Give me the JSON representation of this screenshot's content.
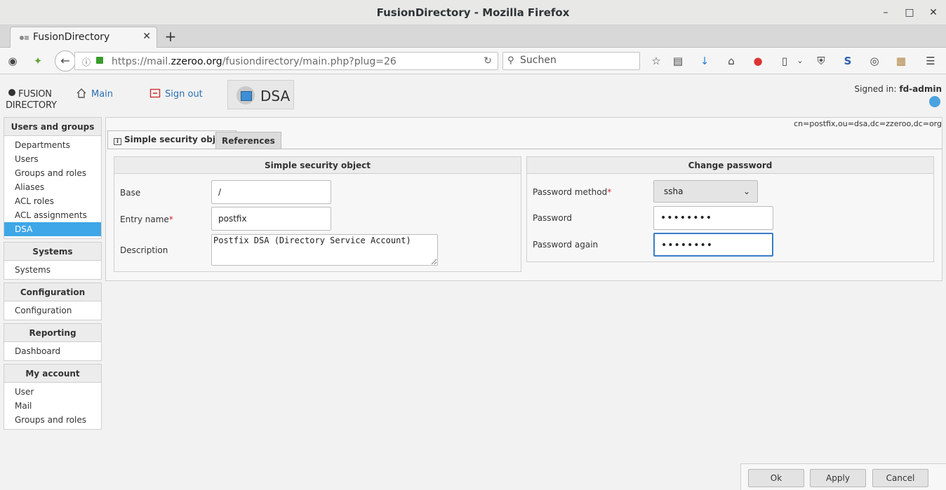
{
  "window": {
    "title": "FusionDirectory - Mozilla Firefox"
  },
  "browser": {
    "tab_title": "FusionDirectory",
    "url_prefix": "https://mail.",
    "url_domain": "zzeroo.org",
    "url_path": "/fusiondirectory/main.php?plug=26",
    "search_placeholder": "Suchen"
  },
  "header": {
    "logo_line1": "FUSION",
    "logo_line2": "DIRECTORY",
    "main_link": "Main",
    "signout_link": "Sign out",
    "plugin_title": "DSA",
    "signed_in_label": "Signed in:",
    "signed_in_user": "fd-admin"
  },
  "sidebar": {
    "groups": [
      {
        "title": "Users and groups",
        "items": [
          "Departments",
          "Users",
          "Groups and roles",
          "Aliases",
          "ACL roles",
          "ACL assignments",
          "DSA"
        ]
      },
      {
        "title": "Systems",
        "items": [
          "Systems"
        ]
      },
      {
        "title": "Configuration",
        "items": [
          "Configuration"
        ]
      },
      {
        "title": "Reporting",
        "items": [
          "Dashboard"
        ]
      },
      {
        "title": "My account",
        "items": [
          "User",
          "Mail",
          "Groups and roles"
        ]
      }
    ],
    "active_item": "DSA"
  },
  "content": {
    "dn": "cn=postfix,ou=dsa,dc=zzeroo,dc=org",
    "tabs": [
      "Simple security object",
      "References"
    ],
    "left_box": {
      "title": "Simple security object",
      "base_label": "Base",
      "base_value": "/",
      "entry_label": "Entry name",
      "entry_value": "postfix",
      "desc_label": "Description",
      "desc_value": "Postfix DSA (Directory Service Account)"
    },
    "right_box": {
      "title": "Change password",
      "method_label": "Password method",
      "method_value": "ssha",
      "password_label": "Password",
      "password_value": "••••••••",
      "password_again_label": "Password again",
      "password_again_value": "••••••••"
    },
    "required_mark": "*"
  },
  "footer": {
    "ok": "Ok",
    "apply": "Apply",
    "cancel": "Cancel"
  },
  "colors": {
    "accent": "#3ea7e7",
    "link": "#2a6fb3",
    "required": "#d0262f"
  }
}
